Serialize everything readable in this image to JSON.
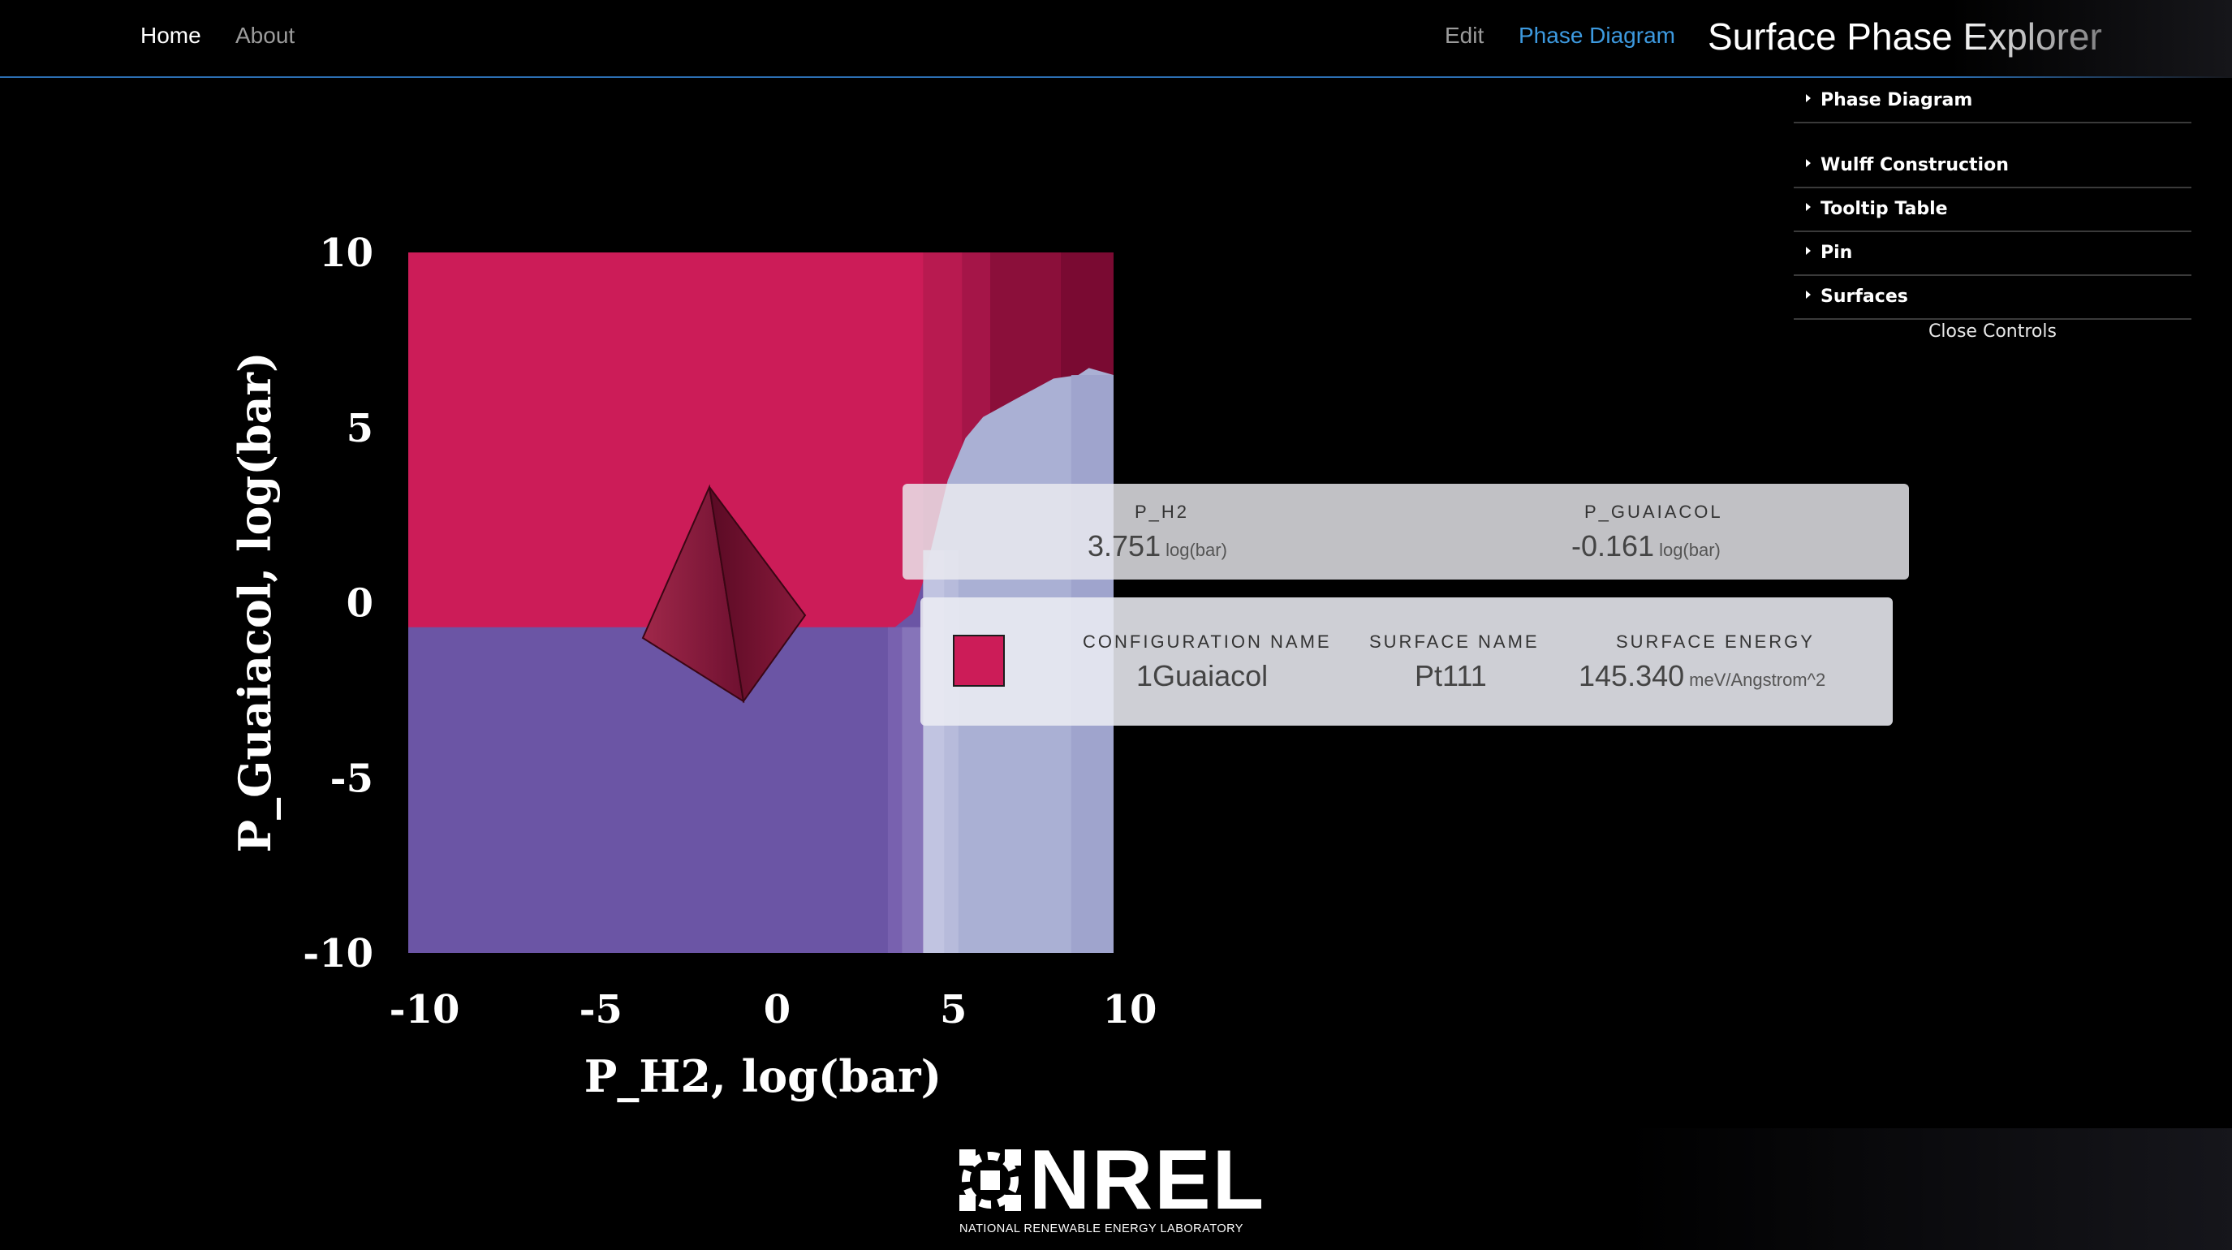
{
  "nav": {
    "home": "Home",
    "about": "About",
    "edit": "Edit",
    "phase_diagram": "Phase Diagram",
    "brand": "Surface Phase Explorer",
    "active_color": "#3d9ae0"
  },
  "controls": {
    "items": [
      {
        "label": "Phase Diagram",
        "icon": "triangle-right-icon"
      },
      {
        "label": "Wulff Construction",
        "icon": "triangle-right-icon"
      },
      {
        "label": "Tooltip Table",
        "icon": "triangle-right-icon"
      },
      {
        "label": "Pin",
        "icon": "triangle-right-icon"
      },
      {
        "label": "Surfaces",
        "icon": "triangle-right-icon"
      }
    ],
    "close_label": "Close Controls"
  },
  "chart_data": {
    "type": "heatmap",
    "title": "",
    "xlabel": "P_H2, log(bar)",
    "ylabel": "P_Guaiacol, log(bar)",
    "xlim": [
      -10,
      10
    ],
    "ylim": [
      -10,
      10
    ],
    "xticks": [
      "-10",
      "-5",
      "0",
      "5",
      "10"
    ],
    "yticks": [
      "10",
      "5",
      "0",
      "-5",
      "-10"
    ],
    "regions": [
      {
        "phase": "1Guaiacol on Pt111",
        "color": "#cc1c58"
      },
      {
        "phase": "lower region",
        "color": "#6b55a5"
      },
      {
        "phase": "right region",
        "color": "#aab0d4"
      }
    ],
    "boundary_lower": [
      [
        -10,
        -0.7
      ],
      [
        3.8,
        -0.7
      ],
      [
        4.3,
        -0.3
      ],
      [
        4.6,
        0.6
      ]
    ],
    "boundary_right": [
      [
        4.6,
        0.6
      ],
      [
        5.3,
        3.5
      ],
      [
        5.8,
        4.7
      ],
      [
        6.3,
        5.3
      ],
      [
        7.2,
        5.8
      ],
      [
        8.3,
        6.4
      ],
      [
        9.0,
        6.5
      ],
      [
        9.3,
        6.7
      ],
      [
        10,
        6.5
      ]
    ],
    "grid": false,
    "legend": "none"
  },
  "tooltip": {
    "pressure": {
      "p_h2_header": "P_H2",
      "p_h2_value": "3.751",
      "p_h2_unit": "log(bar)",
      "p_guaiacol_header": "P_GUAIACOL",
      "p_guaiacol_value": "-0.161",
      "p_guaiacol_unit": "log(bar)"
    },
    "surface": {
      "swatch_color": "#cc1c58",
      "config_header": "CONFIGURATION NAME",
      "config_value": "1Guaiacol",
      "surface_header": "SURFACE NAME",
      "surface_value": "Pt111",
      "energy_header": "SURFACE ENERGY",
      "energy_value": "145.340",
      "energy_unit": "meV/Angstrom^2"
    }
  },
  "footer": {
    "logo_word": "NREL",
    "logo_sub": "NATIONAL RENEWABLE ENERGY LABORATORY",
    "logo_icon": "nrel-emblem-icon"
  }
}
